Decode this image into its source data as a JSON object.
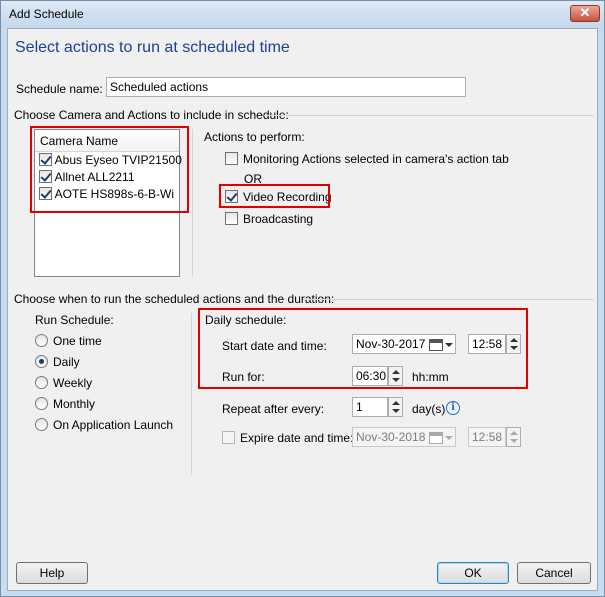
{
  "window": {
    "title": "Add Schedule",
    "close_label": "✕"
  },
  "heading": "Select actions to run at scheduled time",
  "schedule_name": {
    "label": "Schedule name:",
    "value": "Scheduled actions"
  },
  "camera_group": {
    "title": "Choose Camera and Actions to include in schedule:",
    "list_header": "Camera Name",
    "cameras": [
      {
        "name": "Abus Eyseo TVIP21500",
        "checked": true
      },
      {
        "name": "Allnet ALL2211",
        "checked": true
      },
      {
        "name": "AOTE HS898s-6-B-Wi",
        "checked": true
      }
    ]
  },
  "actions": {
    "title": "Actions to perform:",
    "monitoring": {
      "label": "Monitoring Actions selected in camera's action tab",
      "checked": false
    },
    "or_label": "OR",
    "video_recording": {
      "label": "Video Recording",
      "checked": true
    },
    "broadcasting": {
      "label": "Broadcasting",
      "checked": false
    }
  },
  "run_group": {
    "title": "Choose when to run the scheduled actions and the duration:",
    "run_schedule_label": "Run Schedule:",
    "options": [
      {
        "label": "One time",
        "selected": false
      },
      {
        "label": "Daily",
        "selected": true
      },
      {
        "label": "Weekly",
        "selected": false
      },
      {
        "label": "Monthly",
        "selected": false
      },
      {
        "label": "On Application Launch",
        "selected": false
      }
    ]
  },
  "daily": {
    "title": "Daily schedule:",
    "start_label": "Start date and time:",
    "start_date": "Nov-30-2017",
    "start_time": "12:58",
    "run_for_label": "Run for:",
    "run_for_value": "06:30",
    "run_for_unit": "hh:mm",
    "repeat_label": "Repeat after every:",
    "repeat_value": "1",
    "repeat_unit": "day(s)",
    "expire_label": "Expire date and time:",
    "expire_checked": false,
    "expire_date": "Nov-30-2018",
    "expire_time": "12:58"
  },
  "buttons": {
    "help": "Help",
    "ok": "OK",
    "cancel": "Cancel"
  },
  "colors": {
    "highlight_red": "#e00000",
    "heading_blue": "#1e3f9a"
  }
}
